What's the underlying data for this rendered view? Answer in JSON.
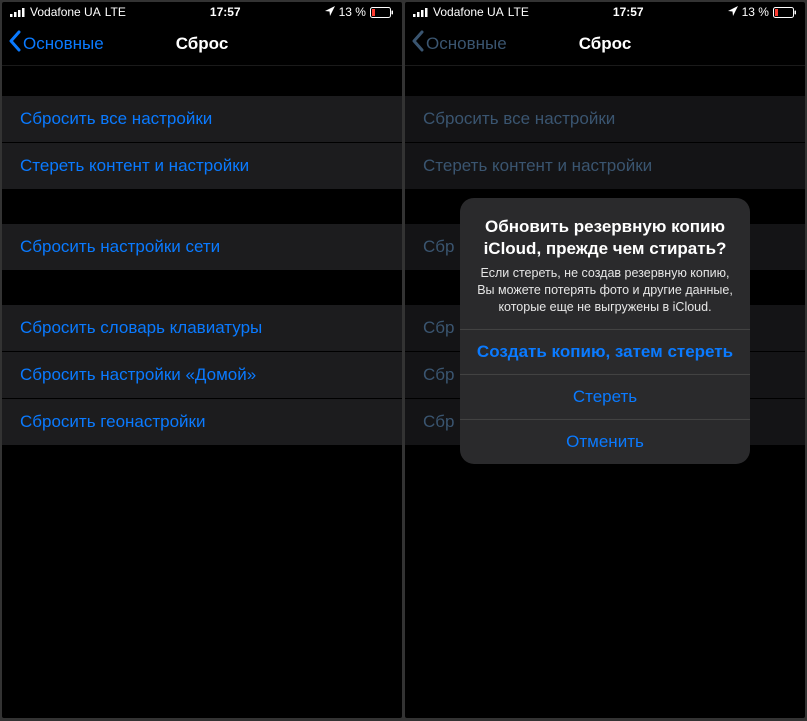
{
  "status": {
    "carrier": "Vodafone UA",
    "network": "LTE",
    "time": "17:57",
    "battery_text": "13 %"
  },
  "nav": {
    "back_label": "Основные",
    "title": "Сброс"
  },
  "groups": [
    {
      "items": [
        "Сбросить все настройки",
        "Стереть контент и настройки"
      ]
    },
    {
      "items": [
        "Сбросить настройки сети"
      ]
    },
    {
      "items": [
        "Сбросить словарь клавиатуры",
        "Сбросить настройки «Домой»",
        "Сбросить геонастройки"
      ]
    }
  ],
  "right_truncated": {
    "group1": [
      "Сбросить все настройки",
      "Стереть контент и настройки"
    ],
    "group2": [
      "Сбр"
    ],
    "group3": [
      "Сбр",
      "Сбр",
      "Сбр"
    ]
  },
  "alert": {
    "title": "Обновить резервную копию iCloud, прежде чем стирать?",
    "message": "Если стереть, не создав резервную копию, Вы можете потерять фото и другие данные, которые еще не выгружены в iCloud.",
    "buttons": [
      "Создать копию, затем стереть",
      "Стереть",
      "Отменить"
    ]
  }
}
